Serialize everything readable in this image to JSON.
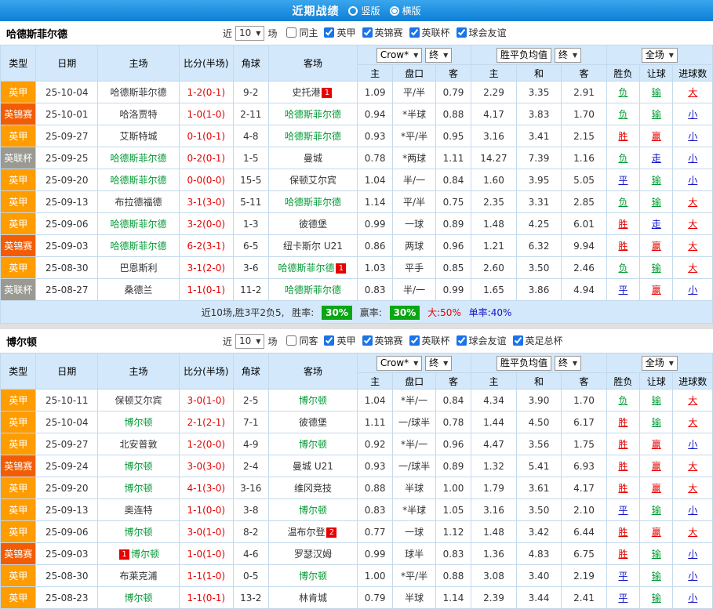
{
  "topbar": {
    "title": "近期战绩",
    "radio_vertical": "竖版",
    "radio_horizontal": "横版",
    "selected": "横版"
  },
  "result_colors": {
    "胜": "#e60000",
    "平": "#1515c8",
    "负": "#009933",
    "赢": "#e60000",
    "走": "#1515c8",
    "输": "#009933",
    "大": "#e60000",
    "小": "#1515c8"
  },
  "league_colors": {
    "英甲": "#ff9c00",
    "英锦赛": "#f25c05",
    "英联杯": "#9a9a93"
  },
  "table_header": {
    "cols": [
      "类型",
      "日期",
      "主场",
      "比分(半场)",
      "角球",
      "客场"
    ],
    "odds_sub": [
      "主",
      "盘口",
      "客"
    ],
    "avg_sub": [
      "主",
      "和",
      "客"
    ],
    "result_sub": [
      "胜负",
      "让球",
      "进球数"
    ],
    "bookmaker_select": "Crow*",
    "final_select": "终",
    "avg_label": "胜平负均值",
    "scope_select": "全场"
  },
  "sections": [
    {
      "team": "哈德斯菲尔德",
      "near_label": "近",
      "count": "10",
      "games_label": "场",
      "filters": [
        {
          "label": "同主",
          "checked": false
        },
        {
          "label": "英甲",
          "checked": true
        },
        {
          "label": "英锦赛",
          "checked": true
        },
        {
          "label": "英联杯",
          "checked": true
        },
        {
          "label": "球会友谊",
          "checked": true
        }
      ],
      "rows": [
        {
          "league": "英甲",
          "date": "25-10-04",
          "home": {
            "name": "哈德斯菲尔德",
            "green": false
          },
          "score": "1-2(0-1)",
          "corners": "9-2",
          "away": {
            "name": "史托港",
            "green": false,
            "badge": "1",
            "badge_pos": "after"
          },
          "odds": [
            "1.09",
            "平/半",
            "0.79"
          ],
          "avgs": [
            "2.29",
            "3.35",
            "2.91"
          ],
          "results": [
            "负",
            "输",
            "大"
          ]
        },
        {
          "league": "英锦赛",
          "date": "25-10-01",
          "home": {
            "name": "哈洛贾特",
            "green": false
          },
          "score": "1-0(1-0)",
          "corners": "2-11",
          "away": {
            "name": "哈德斯菲尔德",
            "green": true
          },
          "odds": [
            "0.94",
            "*半球",
            "0.88"
          ],
          "avgs": [
            "4.17",
            "3.83",
            "1.70"
          ],
          "results": [
            "负",
            "输",
            "小"
          ]
        },
        {
          "league": "英甲",
          "date": "25-09-27",
          "home": {
            "name": "艾斯特城",
            "green": false
          },
          "score": "0-1(0-1)",
          "corners": "4-8",
          "away": {
            "name": "哈德斯菲尔德",
            "green": true
          },
          "odds": [
            "0.93",
            "*平/半",
            "0.95"
          ],
          "avgs": [
            "3.16",
            "3.41",
            "2.15"
          ],
          "results": [
            "胜",
            "赢",
            "小"
          ]
        },
        {
          "league": "英联杯",
          "date": "25-09-25",
          "home": {
            "name": "哈德斯菲尔德",
            "green": true
          },
          "score": "0-2(0-1)",
          "corners": "1-5",
          "away": {
            "name": "曼城",
            "green": false
          },
          "odds": [
            "0.78",
            "*两球",
            "1.11"
          ],
          "avgs": [
            "14.27",
            "7.39",
            "1.16"
          ],
          "results": [
            "负",
            "走",
            "小"
          ]
        },
        {
          "league": "英甲",
          "date": "25-09-20",
          "home": {
            "name": "哈德斯菲尔德",
            "green": true
          },
          "score": "0-0(0-0)",
          "corners": "15-5",
          "away": {
            "name": "保顿艾尔宾",
            "green": false
          },
          "odds": [
            "1.04",
            "半/一",
            "0.84"
          ],
          "avgs": [
            "1.60",
            "3.95",
            "5.05"
          ],
          "results": [
            "平",
            "输",
            "小"
          ]
        },
        {
          "league": "英甲",
          "date": "25-09-13",
          "home": {
            "name": "布拉德福德",
            "green": false
          },
          "score": "3-1(3-0)",
          "corners": "5-11",
          "away": {
            "name": "哈德斯菲尔德",
            "green": true
          },
          "odds": [
            "1.14",
            "平/半",
            "0.75"
          ],
          "avgs": [
            "2.35",
            "3.31",
            "2.85"
          ],
          "results": [
            "负",
            "输",
            "大"
          ]
        },
        {
          "league": "英甲",
          "date": "25-09-06",
          "home": {
            "name": "哈德斯菲尔德",
            "green": true
          },
          "score": "3-2(0-0)",
          "corners": "1-3",
          "away": {
            "name": "彼德堡",
            "green": false
          },
          "odds": [
            "0.99",
            "一球",
            "0.89"
          ],
          "avgs": [
            "1.48",
            "4.25",
            "6.01"
          ],
          "results": [
            "胜",
            "走",
            "大"
          ]
        },
        {
          "league": "英锦赛",
          "date": "25-09-03",
          "home": {
            "name": "哈德斯菲尔德",
            "green": true
          },
          "score": "6-2(3-1)",
          "corners": "6-5",
          "away": {
            "name": "纽卡斯尔 U21",
            "green": false
          },
          "odds": [
            "0.86",
            "两球",
            "0.96"
          ],
          "avgs": [
            "1.21",
            "6.32",
            "9.94"
          ],
          "results": [
            "胜",
            "赢",
            "大"
          ]
        },
        {
          "league": "英甲",
          "date": "25-08-30",
          "home": {
            "name": "巴恩斯利",
            "green": false
          },
          "score": "3-1(2-0)",
          "corners": "3-6",
          "away": {
            "name": "哈德斯菲尔德",
            "green": true,
            "badge": "1",
            "badge_pos": "after"
          },
          "odds": [
            "1.03",
            "平手",
            "0.85"
          ],
          "avgs": [
            "2.60",
            "3.50",
            "2.46"
          ],
          "results": [
            "负",
            "输",
            "大"
          ]
        },
        {
          "league": "英联杯",
          "date": "25-08-27",
          "home": {
            "name": "桑德兰",
            "green": false
          },
          "score": "1-1(0-1)",
          "corners": "11-2",
          "away": {
            "name": "哈德斯菲尔德",
            "green": true
          },
          "odds": [
            "0.83",
            "半/一",
            "0.99"
          ],
          "avgs": [
            "1.65",
            "3.86",
            "4.94"
          ],
          "results": [
            "平",
            "赢",
            "小"
          ]
        }
      ],
      "summary": {
        "text": "近10场,胜3平2负5,",
        "win_label": "胜率:",
        "win_pct": "30%",
        "cover_label": "赢率:",
        "cover_pct": "30%",
        "big": "大:50%",
        "odd": "单率:40%"
      }
    },
    {
      "team": "博尔顿",
      "near_label": "近",
      "count": "10",
      "games_label": "场",
      "filters": [
        {
          "label": "同客",
          "checked": false
        },
        {
          "label": "英甲",
          "checked": true
        },
        {
          "label": "英锦赛",
          "checked": true
        },
        {
          "label": "英联杯",
          "checked": true
        },
        {
          "label": "球会友谊",
          "checked": true
        },
        {
          "label": "英足总杯",
          "checked": true
        }
      ],
      "rows": [
        {
          "league": "英甲",
          "date": "25-10-11",
          "home": {
            "name": "保顿艾尔宾",
            "green": false
          },
          "score": "3-0(1-0)",
          "corners": "2-5",
          "away": {
            "name": "博尔顿",
            "green": true
          },
          "odds": [
            "1.04",
            "*半/一",
            "0.84"
          ],
          "avgs": [
            "4.34",
            "3.90",
            "1.70"
          ],
          "results": [
            "负",
            "输",
            "大"
          ]
        },
        {
          "league": "英甲",
          "date": "25-10-04",
          "home": {
            "name": "博尔顿",
            "green": true
          },
          "score": "2-1(2-1)",
          "corners": "7-1",
          "away": {
            "name": "彼德堡",
            "green": false
          },
          "odds": [
            "1.11",
            "一/球半",
            "0.78"
          ],
          "avgs": [
            "1.44",
            "4.50",
            "6.17"
          ],
          "results": [
            "胜",
            "输",
            "大"
          ]
        },
        {
          "league": "英甲",
          "date": "25-09-27",
          "home": {
            "name": "北安普敦",
            "green": false
          },
          "score": "1-2(0-0)",
          "corners": "4-9",
          "away": {
            "name": "博尔顿",
            "green": true
          },
          "odds": [
            "0.92",
            "*半/一",
            "0.96"
          ],
          "avgs": [
            "4.47",
            "3.56",
            "1.75"
          ],
          "results": [
            "胜",
            "赢",
            "小"
          ]
        },
        {
          "league": "英锦赛",
          "date": "25-09-24",
          "home": {
            "name": "博尔顿",
            "green": true
          },
          "score": "3-0(3-0)",
          "corners": "2-4",
          "away": {
            "name": "曼城 U21",
            "green": false
          },
          "odds": [
            "0.93",
            "一/球半",
            "0.89"
          ],
          "avgs": [
            "1.32",
            "5.41",
            "6.93"
          ],
          "results": [
            "胜",
            "赢",
            "大"
          ]
        },
        {
          "league": "英甲",
          "date": "25-09-20",
          "home": {
            "name": "博尔顿",
            "green": true
          },
          "score": "4-1(3-0)",
          "corners": "3-16",
          "away": {
            "name": "维冈竞技",
            "green": false
          },
          "odds": [
            "0.88",
            "半球",
            "1.00"
          ],
          "avgs": [
            "1.79",
            "3.61",
            "4.17"
          ],
          "results": [
            "胜",
            "赢",
            "大"
          ]
        },
        {
          "league": "英甲",
          "date": "25-09-13",
          "home": {
            "name": "奥连特",
            "green": false
          },
          "score": "1-1(0-0)",
          "corners": "3-8",
          "away": {
            "name": "博尔顿",
            "green": true
          },
          "odds": [
            "0.83",
            "*半球",
            "1.05"
          ],
          "avgs": [
            "3.16",
            "3.50",
            "2.10"
          ],
          "results": [
            "平",
            "输",
            "小"
          ]
        },
        {
          "league": "英甲",
          "date": "25-09-06",
          "home": {
            "name": "博尔顿",
            "green": true
          },
          "score": "3-0(1-0)",
          "corners": "8-2",
          "away": {
            "name": "温布尔登",
            "green": false,
            "badge": "2",
            "badge_pos": "after"
          },
          "odds": [
            "0.77",
            "一球",
            "1.12"
          ],
          "avgs": [
            "1.48",
            "3.42",
            "6.44"
          ],
          "results": [
            "胜",
            "赢",
            "大"
          ]
        },
        {
          "league": "英锦赛",
          "date": "25-09-03",
          "home": {
            "name": "博尔顿",
            "green": true,
            "badge": "1",
            "badge_pos": "before"
          },
          "score": "1-0(1-0)",
          "corners": "4-6",
          "away": {
            "name": "罗瑟汉姆",
            "green": false
          },
          "odds": [
            "0.99",
            "球半",
            "0.83"
          ],
          "avgs": [
            "1.36",
            "4.83",
            "6.75"
          ],
          "results": [
            "胜",
            "输",
            "小"
          ]
        },
        {
          "league": "英甲",
          "date": "25-08-30",
          "home": {
            "name": "布莱克浦",
            "green": false
          },
          "score": "1-1(1-0)",
          "corners": "0-5",
          "away": {
            "name": "博尔顿",
            "green": true
          },
          "odds": [
            "1.00",
            "*平/半",
            "0.88"
          ],
          "avgs": [
            "3.08",
            "3.40",
            "2.19"
          ],
          "results": [
            "平",
            "输",
            "小"
          ]
        },
        {
          "league": "英甲",
          "date": "25-08-23",
          "home": {
            "name": "博尔顿",
            "green": true
          },
          "score": "1-1(0-1)",
          "corners": "13-2",
          "away": {
            "name": "林肯城",
            "green": false
          },
          "odds": [
            "0.79",
            "半球",
            "1.14"
          ],
          "avgs": [
            "2.39",
            "3.44",
            "2.41"
          ],
          "results": [
            "平",
            "输",
            "小"
          ]
        }
      ]
    }
  ]
}
